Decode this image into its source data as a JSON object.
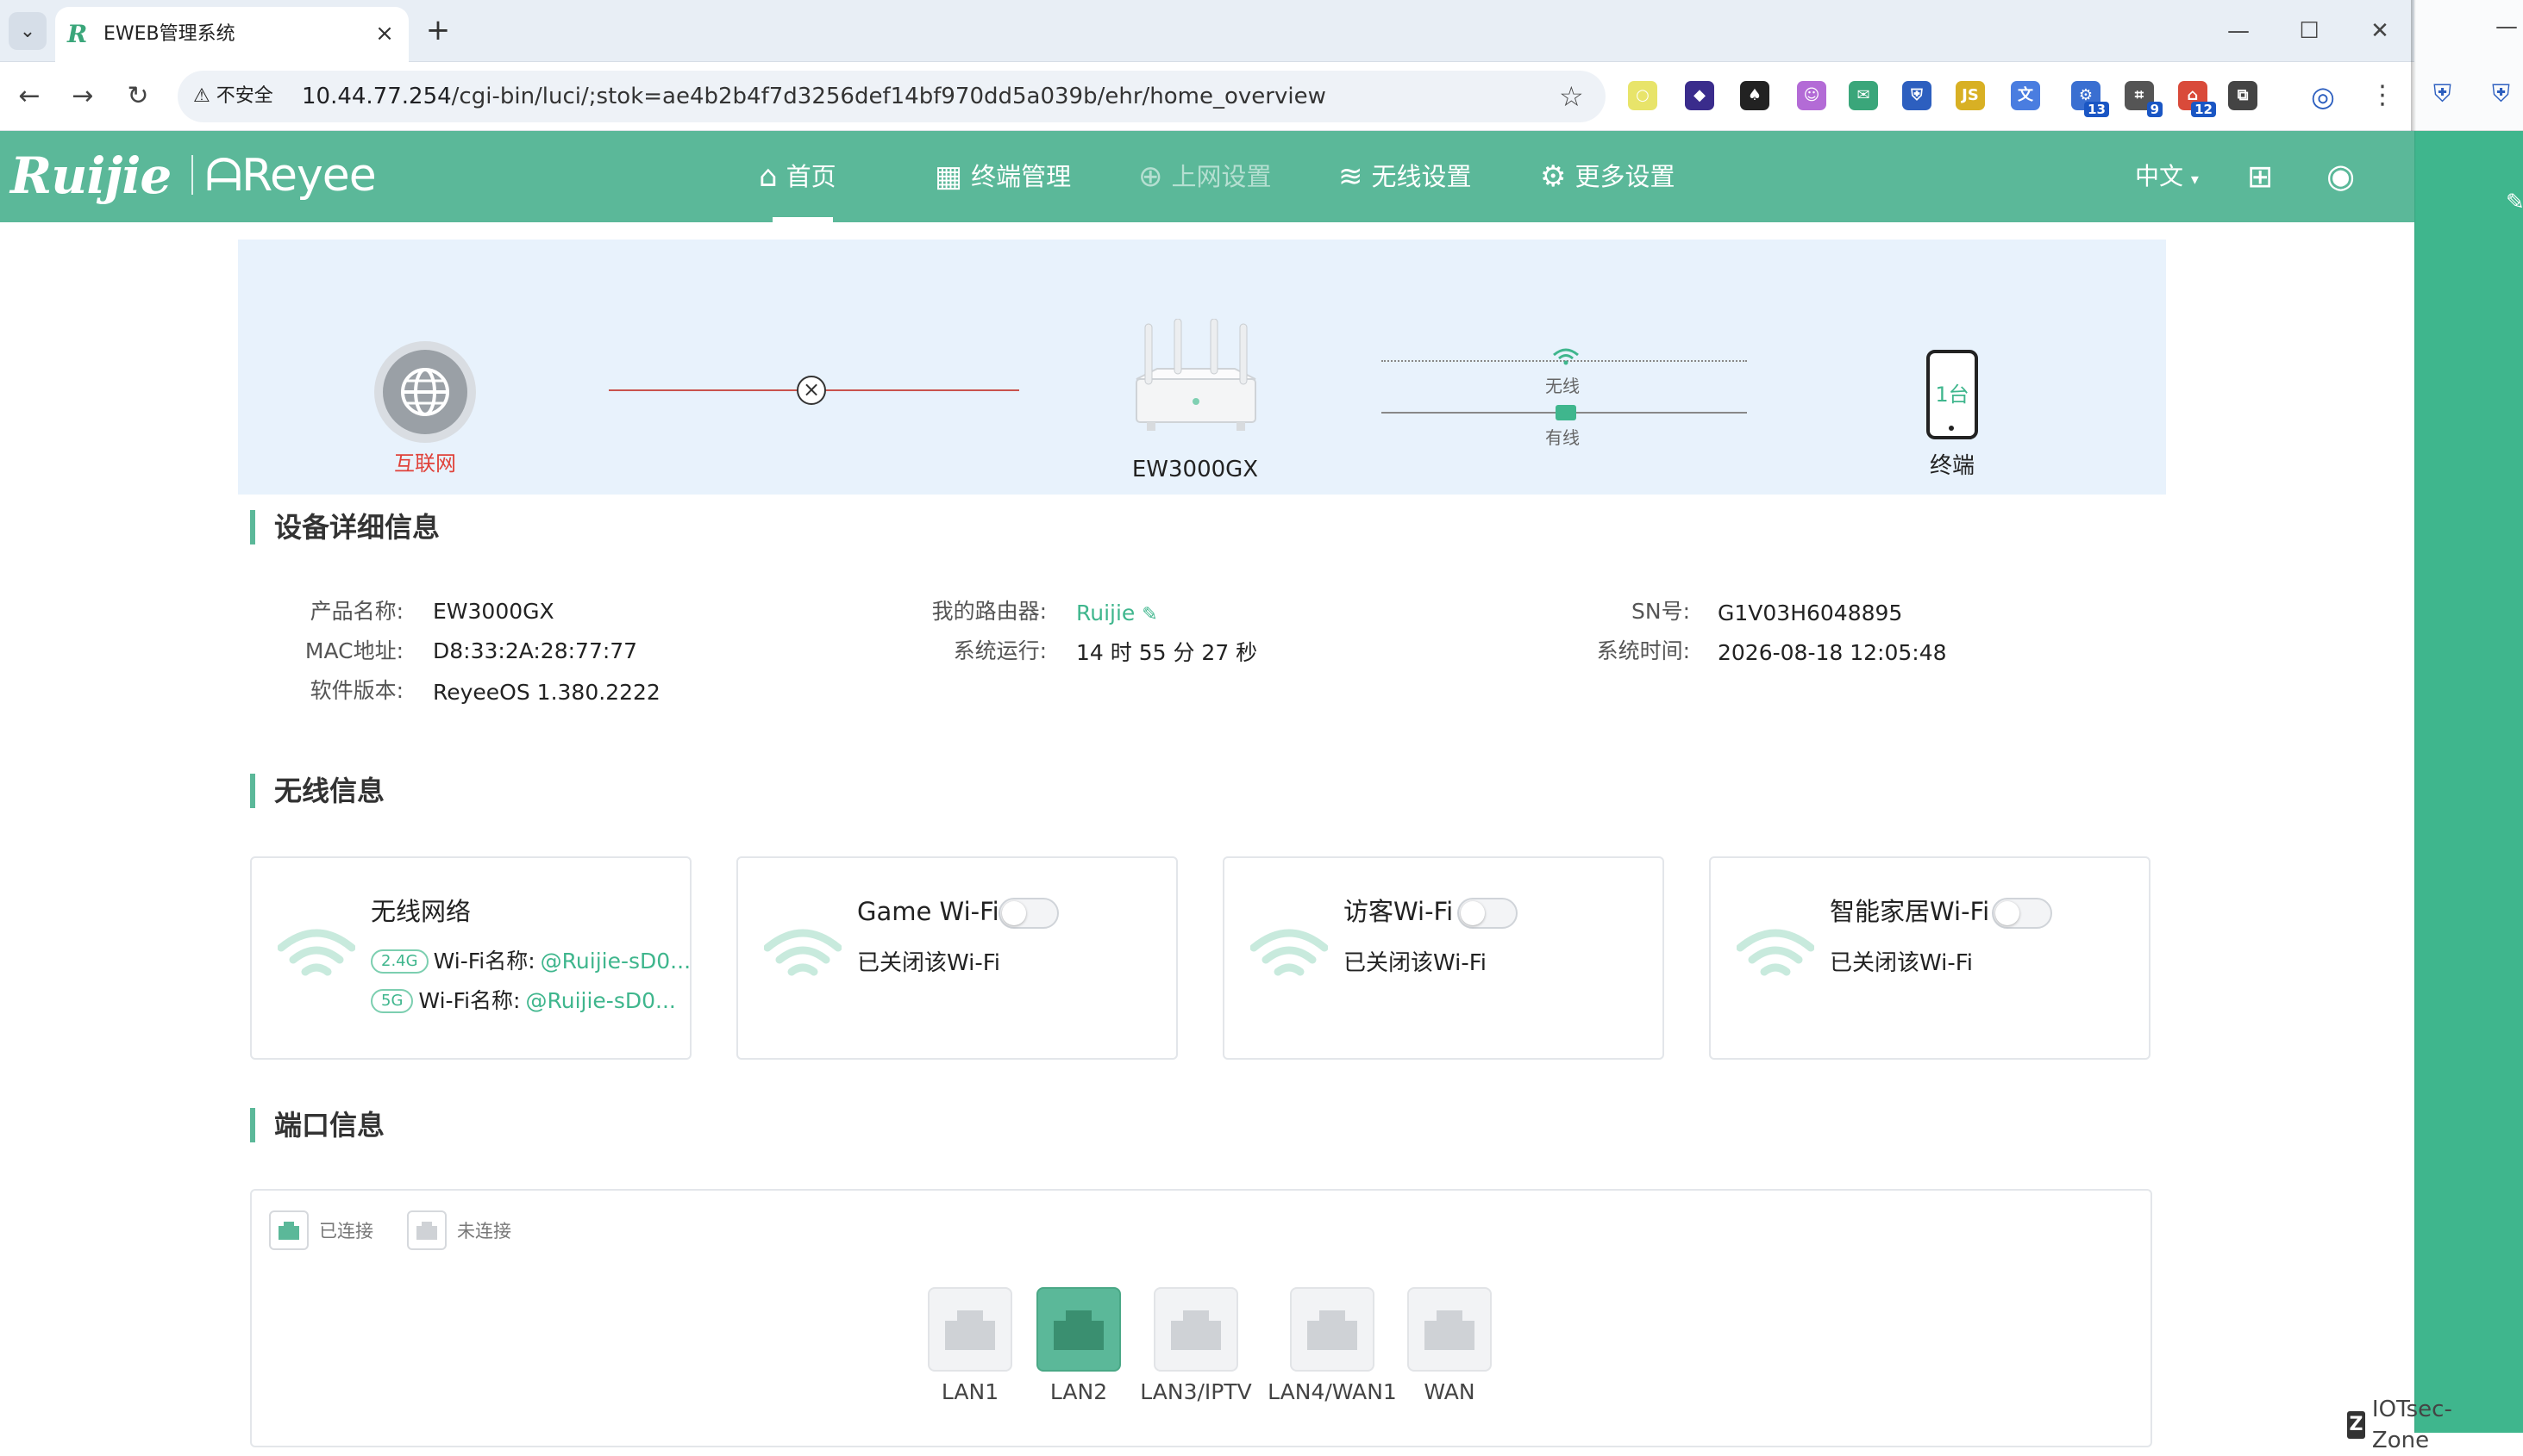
{
  "browser": {
    "tab_title": "EWEB管理系统",
    "insecure_label": "不安全",
    "url_host": "10.44.77.254",
    "url_path": "/cgi-bin/luci/;stok=ae4b2b4f7d3256def14bf970dd5a039b/ehr/home_overview",
    "extensions": [
      {
        "name": "circle-ext-icon",
        "color": "#e8e46a",
        "glyph": "○"
      },
      {
        "name": "diamond-ext-icon",
        "color": "#3a2c8c",
        "glyph": "◆"
      },
      {
        "name": "spade-ext-icon",
        "color": "#222222",
        "glyph": "♠"
      },
      {
        "name": "cat-ext-icon",
        "color": "#b36bd6",
        "glyph": "☺"
      },
      {
        "name": "mail-ext-icon",
        "color": "#3aa67a",
        "glyph": "✉"
      },
      {
        "name": "shield-ext-icon",
        "color": "#2d5fbf",
        "glyph": "⛨"
      },
      {
        "name": "js-ext-icon",
        "color": "#d8b024",
        "glyph": "JS"
      },
      {
        "name": "translate-ext-icon",
        "color": "#4a7de0",
        "glyph": "文"
      },
      {
        "name": "tools-ext-icon",
        "color": "#3a6fd1",
        "glyph": "⚙",
        "badge": "13"
      },
      {
        "name": "capture-ext-icon",
        "color": "#555555",
        "glyph": "⌗",
        "badge": "9"
      },
      {
        "name": "house-ext-icon",
        "color": "#d94a3a",
        "glyph": "⌂",
        "badge": "12"
      },
      {
        "name": "puzzle-ext-icon",
        "color": "#444444",
        "glyph": "⧉"
      }
    ]
  },
  "header": {
    "nav": [
      {
        "label": "首页",
        "icon": "home-icon",
        "glyph": "⌂",
        "active": true
      },
      {
        "label": "终端管理",
        "icon": "grid-icon",
        "glyph": "▦",
        "active": false
      },
      {
        "label": "上网设置",
        "icon": "globe-icon",
        "glyph": "⊕",
        "active": false,
        "disabled": true
      },
      {
        "label": "无线设置",
        "icon": "wifi-icon",
        "glyph": "≋",
        "active": false
      },
      {
        "label": "更多设置",
        "icon": "gear-icon",
        "glyph": "⚙",
        "active": false
      }
    ],
    "language": "中文"
  },
  "topology": {
    "internet_label": "互联网",
    "router_label": "EW3000GX",
    "wireless_label": "无线",
    "wired_label": "有线",
    "terminal_count": "1台",
    "terminal_label": "终端",
    "colors": {
      "internet_error": "#e0423a",
      "accent": "#3fb68d"
    }
  },
  "device": {
    "title": "设备详细信息",
    "fields": [
      {
        "label": "产品名称:",
        "value": "EW3000GX"
      },
      {
        "label": "MAC地址:",
        "value": "D8:33:2A:28:77:77"
      },
      {
        "label": "软件版本:",
        "value": "ReyeeOS 1.380.2222"
      },
      {
        "label": "我的路由器:",
        "value": "Ruijie"
      },
      {
        "label": "系统运行:",
        "value": "14 时 55 分 27 秒"
      },
      {
        "label": "SN号:",
        "value": "G1V03H6048895"
      },
      {
        "label": "系统时间:",
        "value": "2026-08-18 12:05:48"
      }
    ]
  },
  "wireless": {
    "title": "无线信息",
    "main": {
      "title": "无线网络",
      "bands": [
        {
          "band": "2.4G",
          "label": "Wi-Fi名称:",
          "ssid": "@Ruijie-sD0..."
        },
        {
          "band": "5G",
          "label": "Wi-Fi名称:",
          "ssid": "@Ruijie-sD0..."
        }
      ]
    },
    "cards": [
      {
        "title": "Game Wi-Fi",
        "status": "已关闭该Wi-Fi",
        "enabled": false
      },
      {
        "title": "访客Wi-Fi",
        "status": "已关闭该Wi-Fi",
        "enabled": false
      },
      {
        "title": "智能家居Wi-Fi",
        "status": "已关闭该Wi-Fi",
        "enabled": false
      }
    ]
  },
  "ports": {
    "title": "端口信息",
    "legend_connected": "已连接",
    "legend_disconnected": "未连接",
    "list": [
      {
        "name": "LAN1",
        "connected": false
      },
      {
        "name": "LAN2",
        "connected": true
      },
      {
        "name": "LAN3/IPTV",
        "connected": false
      },
      {
        "name": "LAN4/WAN1",
        "connected": false
      },
      {
        "name": "WAN",
        "connected": false
      }
    ]
  },
  "watermark": "IOTsec-Zone"
}
